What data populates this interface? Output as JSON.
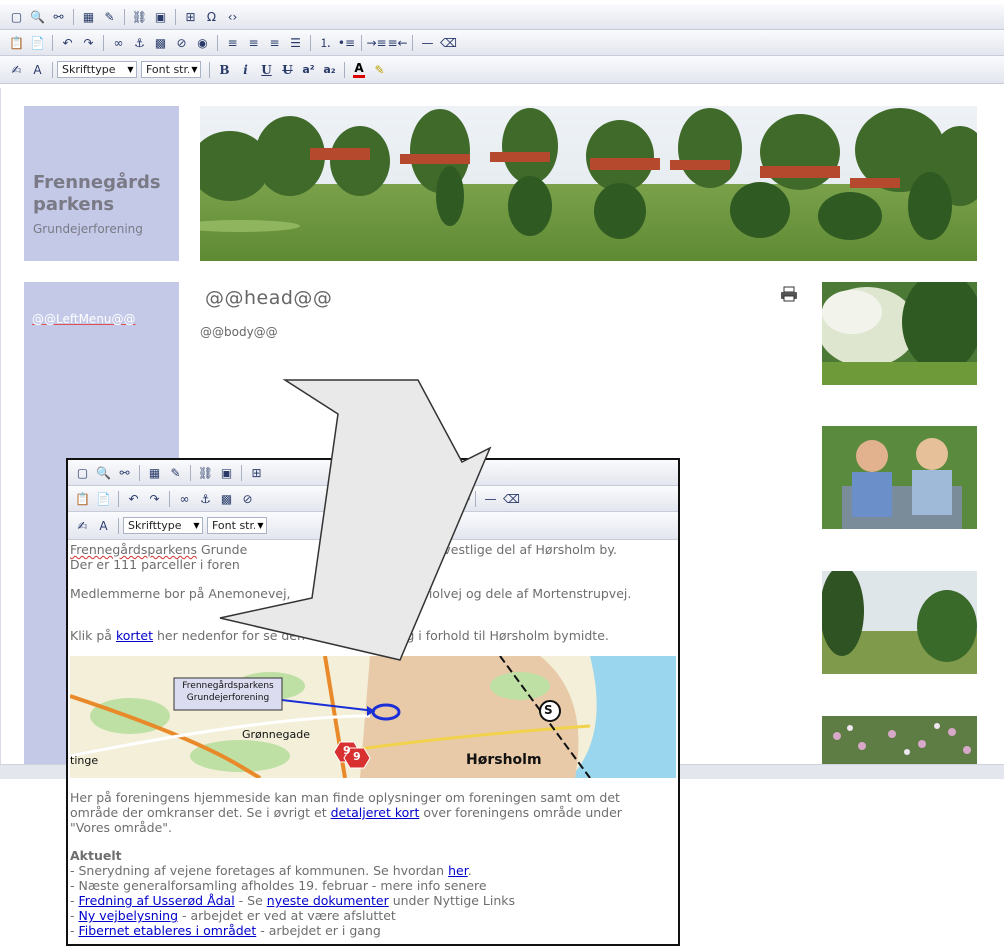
{
  "editor": {
    "font_select": "Skrifttype",
    "size_select": "Font str.",
    "superscript_label": "a²",
    "subscript_label": "a₂"
  },
  "site": {
    "title_line1": "Frennegårds",
    "title_line2": "parkens",
    "subtitle": "Grundejerforening",
    "left_menu": "@@LeftMenu@@",
    "head_placeholder": "@@head@@",
    "body_placeholder": "@@body@@"
  },
  "zoom": {
    "p1_link": "Frennegårdsparkens",
    "p1_a": " Grunde",
    "p1_b": "gende i den vestlige del af Hørsholm by.",
    "p1_c": "Der er 111 parceller i foren",
    "p2_a": "Medlemmerne bor på Anemonevej,",
    "p2_b": "Erantisvej, Violvej og dele af Mortenstrupvej.",
    "p3_a": "Klik på ",
    "p3_link": "kortet",
    "p3_b": " her nedenfor for se den ",
    "p3_c": "rmere placering i forhold til Hørsholm bymidte.",
    "map": {
      "callout_line1": "Frennegårdsparkens",
      "callout_line2": "Grundejerforening",
      "label_tinge": "tinge",
      "label_gronnegade": "Grønnegade",
      "label_horsholm": "Hørsholm",
      "road_9a": "9",
      "road_9b": "9",
      "station": "S"
    },
    "p4_a": "Her på foreningens hjemmeside kan man finde oplysninger om foreningen samt om det",
    "p4_b": "område der omkranser det. Se i øvrigt et ",
    "p4_link": "detaljeret kort",
    "p4_c": " over foreningens område under",
    "p4_d": "\"Vores område\".",
    "aktuelt_heading": "Aktuelt",
    "news": {
      "n1_a": "- Snerydning af vejene foretages af kommunen. Se hvordan ",
      "n1_link": "her",
      "n1_b": ".",
      "n2": "- Næste generalforsamling afholdes 19. februar - mere info senere",
      "n3_prefix": "- ",
      "n3_link": "Fredning af Usserød Ådal",
      "n3_mid": " - Se ",
      "n3_link2": "nyeste dokumenter",
      "n3_b": " under Nyttige Links",
      "n4_prefix": "- ",
      "n4_link": "Ny vejbelysning",
      "n4_b": " - arbejdet er ved at være afsluttet",
      "n5_prefix": "- ",
      "n5_link": "Fibernet etableres i området",
      "n5_b": " - arbejdet er i gang"
    }
  },
  "colors": {
    "site_block": "#c4c9e8",
    "link": "#0000cc",
    "arrow_fill": "#e9e9e9",
    "map_road_orange": "#e98a2a",
    "map_callout_line": "#1a2fd6"
  }
}
